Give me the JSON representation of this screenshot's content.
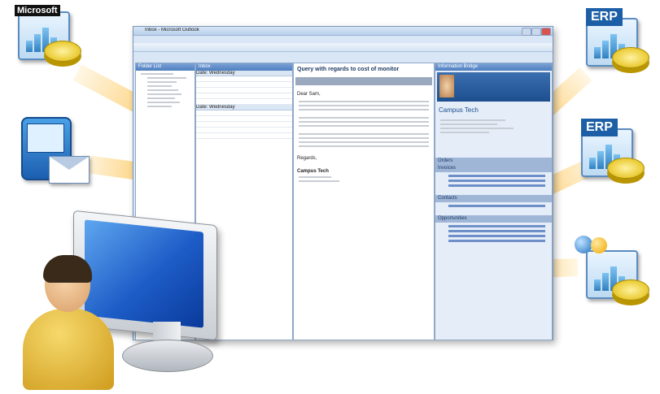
{
  "tags": {
    "microsoft": "Microsoft",
    "erp_top": "ERP",
    "erp_middle": "ERP"
  },
  "window": {
    "title": "Inbox - Microsoft Outlook",
    "folder_pane_title": "Folder List",
    "inbox_pane_title": "Inbox",
    "group_wednesday": "Date: Wednesday",
    "group_wednesday2": "Date: Wednesday",
    "reading_subject": "Query with regards to cost of monitor",
    "salutation": "Dear Sam,",
    "signoff": "Regards,",
    "sender_company": "Campus Tech",
    "info_bridge_title": "Information Bridge",
    "contact_company": "Campus Tech",
    "sections": [
      "Orders",
      "Invoices",
      "Contacts",
      "Opportunities"
    ]
  },
  "colors": {
    "arrow": "#f7b52c",
    "accent_blue": "#1d5fa6",
    "coin": "#e0b800"
  }
}
